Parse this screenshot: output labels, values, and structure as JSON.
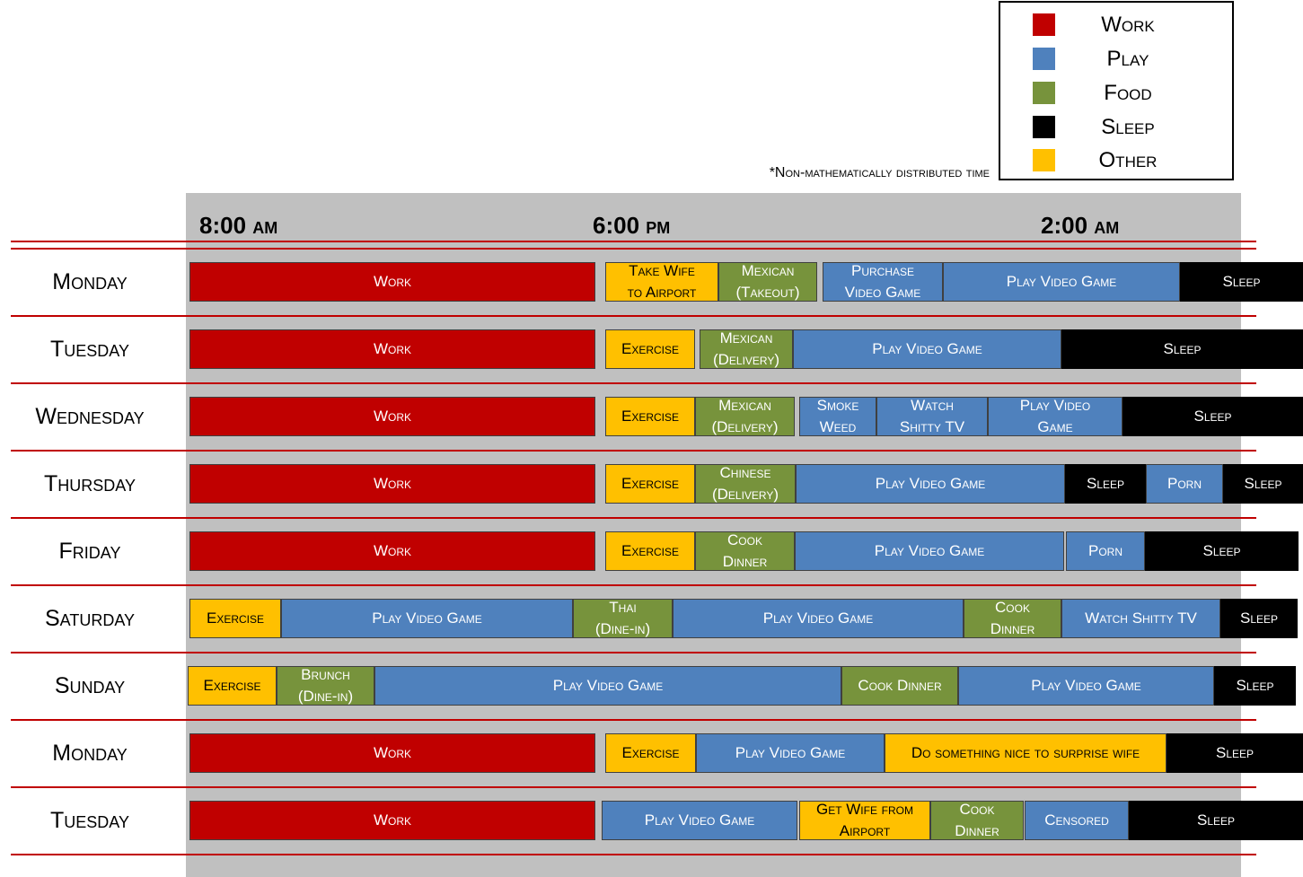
{
  "legend": {
    "items": [
      {
        "key": "work",
        "label": "Work",
        "color": "#c00000"
      },
      {
        "key": "play",
        "label": "Play",
        "color": "#4f81bd"
      },
      {
        "key": "food",
        "label": "Food",
        "color": "#77933c"
      },
      {
        "key": "sleep",
        "label": "Sleep",
        "color": "#000000"
      },
      {
        "key": "other",
        "label": "Other",
        "color": "#ffc000"
      }
    ]
  },
  "note": "*Non-mathematically distributed time",
  "time_labels": [
    {
      "num": "8:00",
      "suffix": "am"
    },
    {
      "num": "6:00",
      "suffix": "pm"
    },
    {
      "num": "2:00",
      "suffix": "am"
    }
  ],
  "days": [
    {
      "label": "Monday",
      "segments": [
        {
          "text": "Work",
          "cat": "work"
        },
        {
          "text": "Take Wife\nto Airport",
          "cat": "other"
        },
        {
          "text": "Mexican\n(Takeout)",
          "cat": "food"
        },
        {
          "text": "Purchase\nVideo Game",
          "cat": "play"
        },
        {
          "text": "Play Video Game",
          "cat": "play"
        },
        {
          "text": "Sleep",
          "cat": "sleep"
        }
      ]
    },
    {
      "label": "Tuesday",
      "segments": [
        {
          "text": "Work",
          "cat": "work"
        },
        {
          "text": "Exercise",
          "cat": "other"
        },
        {
          "text": "Mexican\n(Delivery)",
          "cat": "food"
        },
        {
          "text": "Play Video Game",
          "cat": "play"
        },
        {
          "text": "Sleep",
          "cat": "sleep"
        }
      ]
    },
    {
      "label": "Wednesday",
      "segments": [
        {
          "text": "Work",
          "cat": "work"
        },
        {
          "text": "Exercise",
          "cat": "other"
        },
        {
          "text": "Mexican\n(Delivery)",
          "cat": "food"
        },
        {
          "text": "Smoke\nWeed",
          "cat": "play"
        },
        {
          "text": "Watch\nShitty TV",
          "cat": "play"
        },
        {
          "text": "Play Video\nGame",
          "cat": "play"
        },
        {
          "text": "Sleep",
          "cat": "sleep"
        }
      ]
    },
    {
      "label": "Thursday",
      "segments": [
        {
          "text": "Work",
          "cat": "work"
        },
        {
          "text": "Exercise",
          "cat": "other"
        },
        {
          "text": "Chinese\n(Delivery)",
          "cat": "food"
        },
        {
          "text": "Play Video Game",
          "cat": "play"
        },
        {
          "text": "Sleep",
          "cat": "sleep"
        },
        {
          "text": "Porn",
          "cat": "play"
        },
        {
          "text": "Sleep",
          "cat": "sleep"
        }
      ]
    },
    {
      "label": "Friday",
      "segments": [
        {
          "text": "Work",
          "cat": "work"
        },
        {
          "text": "Exercise",
          "cat": "other"
        },
        {
          "text": "Cook\nDinner",
          "cat": "food"
        },
        {
          "text": "Play Video Game",
          "cat": "play"
        },
        {
          "text": "Porn",
          "cat": "play"
        },
        {
          "text": "Sleep",
          "cat": "sleep"
        }
      ]
    },
    {
      "label": "Saturday",
      "segments": [
        {
          "text": "Exercise",
          "cat": "other"
        },
        {
          "text": "Play Video Game",
          "cat": "play"
        },
        {
          "text": "Thai\n(Dine-in)",
          "cat": "food"
        },
        {
          "text": "Play Video Game",
          "cat": "play"
        },
        {
          "text": "Cook\nDinner",
          "cat": "food"
        },
        {
          "text": "Watch Shitty TV",
          "cat": "play"
        },
        {
          "text": "Sleep",
          "cat": "sleep"
        }
      ]
    },
    {
      "label": "Sunday",
      "segments": [
        {
          "text": "Exercise",
          "cat": "other"
        },
        {
          "text": "Brunch\n(Dine-in)",
          "cat": "food"
        },
        {
          "text": "Play Video Game",
          "cat": "play"
        },
        {
          "text": "Cook Dinner",
          "cat": "food"
        },
        {
          "text": "Play Video Game",
          "cat": "play"
        },
        {
          "text": "Sleep",
          "cat": "sleep"
        }
      ]
    },
    {
      "label": "Monday",
      "segments": [
        {
          "text": "Work",
          "cat": "work"
        },
        {
          "text": "Exercise",
          "cat": "other"
        },
        {
          "text": "Play Video Game",
          "cat": "play"
        },
        {
          "text": "Do something nice to surprise wife",
          "cat": "other"
        },
        {
          "text": "Sleep",
          "cat": "sleep"
        }
      ]
    },
    {
      "label": "Tuesday",
      "segments": [
        {
          "text": "Work",
          "cat": "work"
        },
        {
          "text": "Play Video Game",
          "cat": "play"
        },
        {
          "text": "Get Wife from\nAirport",
          "cat": "other"
        },
        {
          "text": "Cook\nDinner",
          "cat": "food"
        },
        {
          "text": "Censored",
          "cat": "play"
        },
        {
          "text": "Sleep",
          "cat": "sleep"
        }
      ]
    }
  ]
}
